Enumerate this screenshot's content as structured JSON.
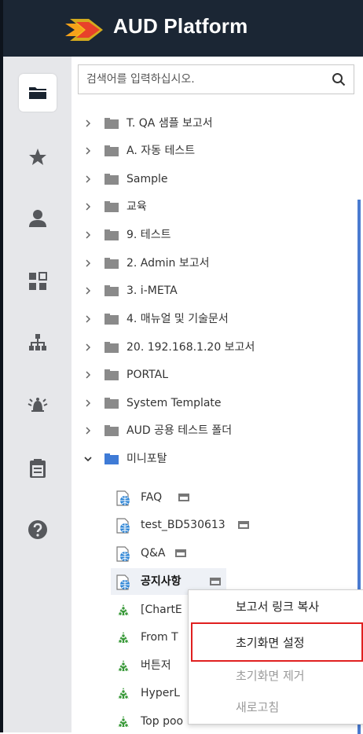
{
  "app": {
    "title": "AUD Platform",
    "logo_icon": "aud-logo-icon"
  },
  "colors": {
    "header_bg": "#1b2634",
    "sidebar_bg": "#e6e7ea",
    "accent": "#3f7bd6",
    "highlight_border": "#e02020"
  },
  "sidebar": {
    "items": [
      {
        "icon": "folder-icon",
        "active": true
      },
      {
        "icon": "star-icon",
        "active": false
      },
      {
        "icon": "user-icon",
        "active": false
      },
      {
        "icon": "dashboard-icon",
        "active": false
      },
      {
        "icon": "org-chart-icon",
        "active": false
      },
      {
        "icon": "bell-icon",
        "active": false
      },
      {
        "icon": "clipboard-icon",
        "active": false
      },
      {
        "icon": "help-icon",
        "active": false
      }
    ]
  },
  "search": {
    "placeholder": "검색어를 입력하십시오.",
    "value": ""
  },
  "tree": {
    "folders": [
      {
        "label": "T. QA 샘플 보고서"
      },
      {
        "label": "A. 자동 테스트"
      },
      {
        "label": "Sample"
      },
      {
        "label": "교육"
      },
      {
        "label": "9. 테스트"
      },
      {
        "label": "2. Admin 보고서"
      },
      {
        "label": "3. i-META"
      },
      {
        "label": "4. 매뉴얼 및 기술문서"
      },
      {
        "label": "20. 192.168.1.20 보고서"
      },
      {
        "label": "PORTAL"
      },
      {
        "label": "System Template"
      },
      {
        "label": "AUD 공용 테스트 폴더"
      }
    ],
    "open_folder": {
      "label": "미니포탈"
    },
    "children": [
      {
        "label": "FAQ",
        "icon": "web-report-icon"
      },
      {
        "label": "test_BD530613",
        "icon": "web-report-icon"
      },
      {
        "label": "Q&A",
        "icon": "web-report-icon"
      },
      {
        "label": "공지사항",
        "icon": "web-report-icon"
      },
      {
        "label": "[ChartE",
        "icon": "green-report-icon"
      },
      {
        "label": "From T",
        "icon": "green-report-icon"
      },
      {
        "label": "버튼저",
        "icon": "green-report-icon"
      },
      {
        "label": "HyperL",
        "icon": "green-report-icon"
      },
      {
        "label": "Top poo",
        "icon": "green-report-icon"
      }
    ]
  },
  "context_menu": {
    "items": [
      {
        "label": "보고서 링크 복사",
        "enabled": true
      },
      {
        "label": "초기화면 설정",
        "enabled": true
      },
      {
        "label": "초기화면 제거",
        "enabled": false
      },
      {
        "label": "새로고침",
        "enabled": false
      }
    ]
  }
}
